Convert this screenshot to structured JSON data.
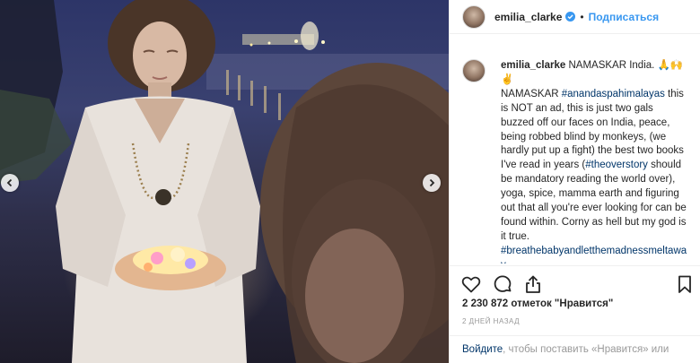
{
  "header": {
    "username": "emilia_clarke",
    "separator": "•",
    "follow_label": "Подписаться"
  },
  "caption": {
    "username": "emilia_clarke",
    "first_line": "NAMASKAR India. 🙏🙌✌",
    "part1": "NAMASKAR ",
    "hashtag1": "#anandaspahimalayas",
    "part2": " this is NOT an ad, this is just two gals buzzed off our faces on India, peace, being robbed blind by monkeys, (we hardly put up a fight) the best two books I've read in years (",
    "hashtag2": "#theoverstory",
    "part3": " should be mandatory reading the world over), yoga, spice, mamma earth and figuring out that all you're ever looking for can be found within. Corny as hell but my god is it true. ",
    "hashtag3": "#breathebabyandletthemadnessmeltaway"
  },
  "stats": {
    "likes": "2 230 872 отметок \"Нравится\"",
    "time": "2 дней назад"
  },
  "bottom": {
    "login_link": "Войдите",
    "rest": ", чтобы поставить «Нравится» или"
  },
  "icons": {
    "like": "heart-icon",
    "comment": "comment-icon",
    "share": "share-icon",
    "save": "bookmark-icon",
    "prev": "chevron-left-icon",
    "next": "chevron-right-icon",
    "verified": "verified-badge-icon"
  },
  "colors": {
    "link": "#3897f0",
    "hashtag": "#003569",
    "muted": "#999999"
  }
}
